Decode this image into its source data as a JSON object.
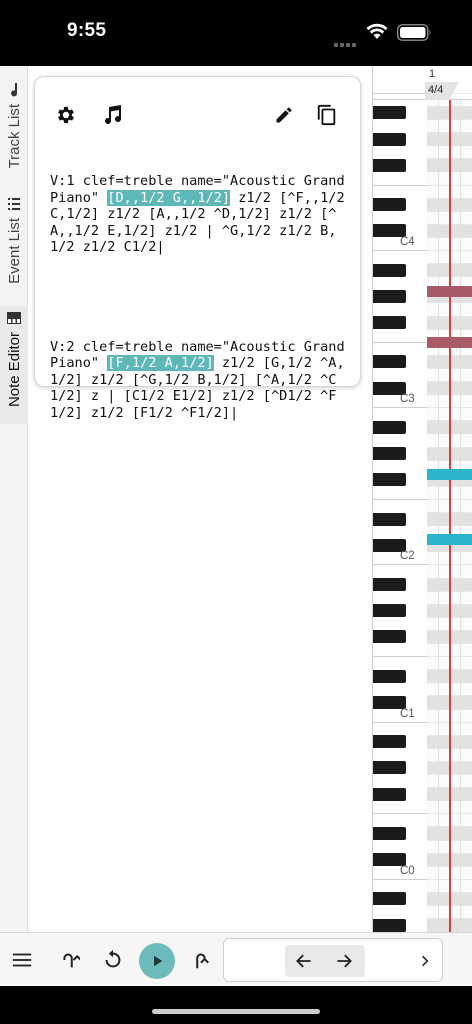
{
  "status_bar": {
    "time": "9:55"
  },
  "side_tabs": [
    {
      "label": "Track List",
      "icon": "music-note-icon",
      "active": false
    },
    {
      "label": "Event List",
      "icon": "list-icon",
      "active": false
    },
    {
      "label": "Note Editor",
      "icon": "piano-icon",
      "active": true
    }
  ],
  "card": {
    "toolbar": {
      "left": [
        "gear-icon",
        "music-notes-icon"
      ],
      "right": [
        "pencil-icon",
        "copy-icon"
      ]
    },
    "voices": [
      {
        "header": "V:1 clef=treble name=\"Acoustic Grand Piano\"",
        "highlight": "[D,,1/2 G,,1/2]",
        "body": " z1/2 [^F,,1/2 C,1/2] z1/2 [A,,1/2 ^D,1/2] z1/2 [^A,,1/2 E,1/2] z1/2 | ^G,1/2 z1/2 B,1/2 z1/2 C1/2|"
      },
      {
        "header": "V:2 clef=treble name=\"Acoustic Grand Piano\"",
        "highlight": "[F,1/2 A,1/2]",
        "body": " z1/2 [G,1/2 ^A,1/2] z1/2 [^G,1/2 B,1/2] [^A,1/2 ^C1/2] z | [C1/2 E1/2] z1/2 [^D1/2 ^F1/2] z1/2 [F1/2 ^F1/2]|"
      }
    ]
  },
  "piano_roll": {
    "measure": "1",
    "time_signature": "4/4",
    "octave_labels": [
      "C4",
      "C3",
      "C2",
      "C1",
      "C0"
    ],
    "note_colors": {
      "selected_other": "#a85a66",
      "selected": "#2bb5c9"
    },
    "playhead_color": "#e53935"
  },
  "bottom_bar": {
    "buttons": [
      "menu-icon",
      "undo-icon",
      "rewind-icon",
      "play-icon",
      "redo-icon"
    ],
    "nav": [
      "arrow-left-icon",
      "arrow-right-icon",
      "chevron-right-icon"
    ],
    "accent": "#6cbcbc"
  }
}
